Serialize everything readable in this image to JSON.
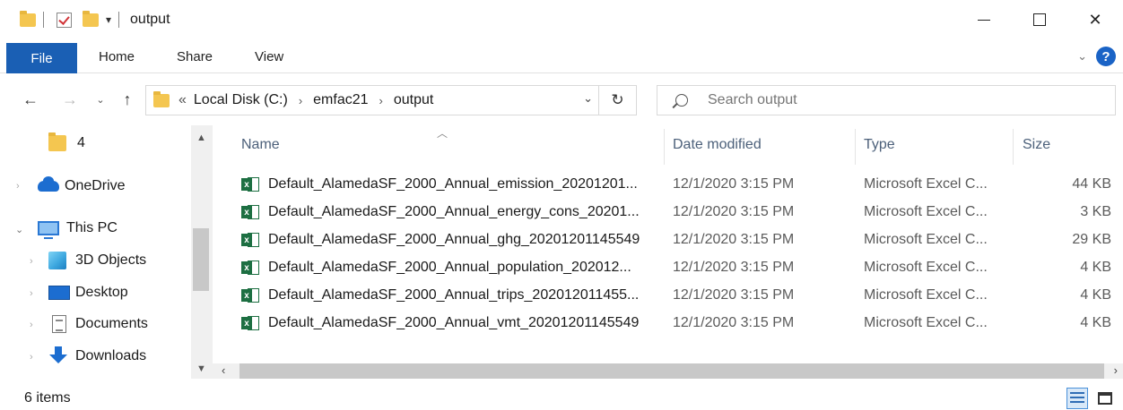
{
  "window": {
    "title": "output",
    "controls": {
      "minimize": "—",
      "maximize": "☐",
      "close": "✕"
    }
  },
  "ribbon": {
    "tabs": [
      "File",
      "Home",
      "Share",
      "View"
    ],
    "help": "?"
  },
  "address": {
    "overflow": "«",
    "crumbs": [
      "Local Disk (C:)",
      "emfac21",
      "output"
    ]
  },
  "search": {
    "placeholder": "Search output"
  },
  "navpane": {
    "items": [
      {
        "label": "4"
      },
      {
        "label": "OneDrive"
      },
      {
        "label": "This PC"
      },
      {
        "label": "3D Objects"
      },
      {
        "label": "Desktop"
      },
      {
        "label": "Documents"
      },
      {
        "label": "Downloads"
      }
    ]
  },
  "columns": {
    "name": "Name",
    "date": "Date modified",
    "type": "Type",
    "size": "Size"
  },
  "files": [
    {
      "name": "Default_AlamedaSF_2000_Annual_emission_20201201...",
      "date": "12/1/2020 3:15 PM",
      "type": "Microsoft Excel C...",
      "size": "44 KB"
    },
    {
      "name": "Default_AlamedaSF_2000_Annual_energy_cons_20201...",
      "date": "12/1/2020 3:15 PM",
      "type": "Microsoft Excel C...",
      "size": "3 KB"
    },
    {
      "name": "Default_AlamedaSF_2000_Annual_ghg_20201201145549",
      "date": "12/1/2020 3:15 PM",
      "type": "Microsoft Excel C...",
      "size": "29 KB"
    },
    {
      "name": "Default_AlamedaSF_2000_Annual_population_202012...",
      "date": "12/1/2020 3:15 PM",
      "type": "Microsoft Excel C...",
      "size": "4 KB"
    },
    {
      "name": "Default_AlamedaSF_2000_Annual_trips_202012011455...",
      "date": "12/1/2020 3:15 PM",
      "type": "Microsoft Excel C...",
      "size": "4 KB"
    },
    {
      "name": "Default_AlamedaSF_2000_Annual_vmt_20201201145549",
      "date": "12/1/2020 3:15 PM",
      "type": "Microsoft Excel C...",
      "size": "4 KB"
    }
  ],
  "status": {
    "count": "6 items"
  },
  "colors": {
    "file_tab": "#1a5fb4",
    "excel_green": "#1d6f42",
    "header_text": "#4c607a"
  }
}
